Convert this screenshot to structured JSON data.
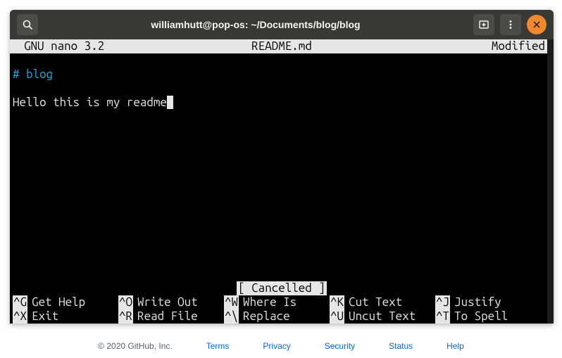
{
  "titlebar": {
    "title": "williamhutt@pop-os: ~/Documents/blog/blog"
  },
  "nano": {
    "header": {
      "version": "GNU nano 3.2",
      "filename": "README.md",
      "status": "Modified"
    },
    "content": {
      "line1_hash": "# blog",
      "line2": "Hello this is my readme"
    },
    "status_message": "[ Cancelled ]",
    "shortcuts": {
      "row1": [
        {
          "key": "^G",
          "label": "Get Help"
        },
        {
          "key": "^O",
          "label": "Write Out"
        },
        {
          "key": "^W",
          "label": "Where Is"
        },
        {
          "key": "^K",
          "label": "Cut Text"
        },
        {
          "key": "^J",
          "label": "Justify"
        }
      ],
      "row2": [
        {
          "key": "^X",
          "label": "Exit"
        },
        {
          "key": "^R",
          "label": "Read File"
        },
        {
          "key": "^\\",
          "label": "Replace"
        },
        {
          "key": "^U",
          "label": "Uncut Text"
        },
        {
          "key": "^T",
          "label": "To Spell"
        }
      ]
    }
  },
  "footer": {
    "copyright": "© 2020 GitHub, Inc.",
    "links": {
      "terms": "Terms",
      "privacy": "Privacy",
      "security": "Security",
      "status": "Status",
      "help": "Help"
    }
  }
}
